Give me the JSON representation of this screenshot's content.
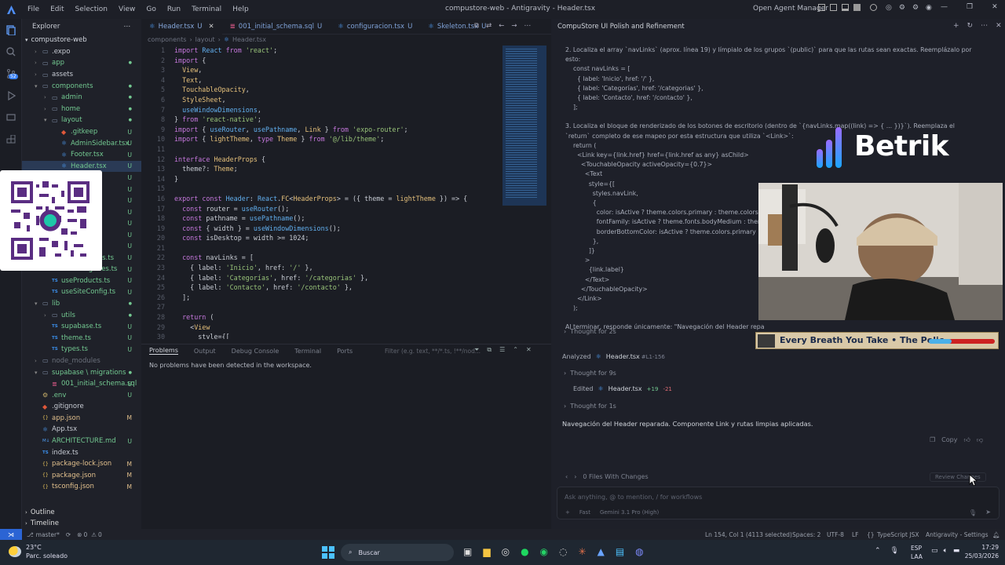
{
  "titlebar": {
    "menus": [
      "File",
      "Edit",
      "Selection",
      "View",
      "Go",
      "Run",
      "Terminal",
      "Help"
    ],
    "title": "compustore-web - Antigravity - Header.tsx",
    "open_agent_manager": "Open Agent Manager"
  },
  "explorer": {
    "title": "Explorer",
    "project": "compustore-web",
    "items": [
      {
        "label": ".expo",
        "indent": 1,
        "type": "folder",
        "status": ""
      },
      {
        "label": "app",
        "indent": 1,
        "type": "folder",
        "status": "dot"
      },
      {
        "label": "assets",
        "indent": 1,
        "type": "folder",
        "status": ""
      },
      {
        "label": "components",
        "indent": 1,
        "type": "folder-open",
        "status": "dot"
      },
      {
        "label": "admin",
        "indent": 2,
        "type": "folder",
        "status": "dot"
      },
      {
        "label": "home",
        "indent": 2,
        "type": "folder",
        "status": "dot"
      },
      {
        "label": "layout",
        "indent": 2,
        "type": "folder-open",
        "status": "dot"
      },
      {
        "label": ".gitkeep",
        "indent": 3,
        "type": "file",
        "status": "U"
      },
      {
        "label": "AdminSidebar.tsx",
        "indent": 3,
        "type": "file",
        "status": "U"
      },
      {
        "label": "Footer.tsx",
        "indent": 3,
        "type": "file",
        "status": "U"
      },
      {
        "label": "Header.tsx",
        "indent": 3,
        "type": "file",
        "status": "U"
      },
      {
        "label": "...tsx",
        "indent": 3,
        "type": "file",
        "status": "U"
      },
      {
        "label": "",
        "indent": 3,
        "type": "file",
        "status": "U"
      },
      {
        "label": "...tsx",
        "indent": 3,
        "type": "file",
        "status": "U"
      },
      {
        "label": "",
        "indent": 3,
        "type": "file",
        "status": "U"
      },
      {
        "label": "",
        "indent": 3,
        "type": "file",
        "status": "U"
      },
      {
        "label": "",
        "indent": 3,
        "type": "file",
        "status": "U"
      },
      {
        "label": "",
        "indent": 3,
        "type": "file",
        "status": "U"
      },
      {
        "label": "useCarousels.ts",
        "indent": 2,
        "type": "file",
        "status": "U"
      },
      {
        "label": "useCategories.ts",
        "indent": 2,
        "type": "file",
        "status": "U"
      },
      {
        "label": "useProducts.ts",
        "indent": 2,
        "type": "file",
        "status": "U"
      },
      {
        "label": "useSiteConfig.ts",
        "indent": 2,
        "type": "file",
        "status": "U"
      },
      {
        "label": "lib",
        "indent": 1,
        "type": "folder-open",
        "status": "dot"
      },
      {
        "label": "utils",
        "indent": 2,
        "type": "folder",
        "status": "dot"
      },
      {
        "label": "supabase.ts",
        "indent": 2,
        "type": "file",
        "status": "U"
      },
      {
        "label": "theme.ts",
        "indent": 2,
        "type": "file",
        "status": "U"
      },
      {
        "label": "types.ts",
        "indent": 2,
        "type": "file",
        "status": "U"
      },
      {
        "label": "node_modules",
        "indent": 1,
        "type": "folder",
        "status": ""
      },
      {
        "label": "supabase \\ migrations",
        "indent": 1,
        "type": "folder-open",
        "status": "dot"
      },
      {
        "label": "001_initial_schema.sql",
        "indent": 2,
        "type": "file",
        "status": "U"
      },
      {
        "label": ".env",
        "indent": 1,
        "type": "file",
        "status": "U"
      },
      {
        "label": ".gitignore",
        "indent": 1,
        "type": "file",
        "status": ""
      },
      {
        "label": "app.json",
        "indent": 1,
        "type": "file",
        "status": "M"
      },
      {
        "label": "App.tsx",
        "indent": 1,
        "type": "file",
        "status": ""
      },
      {
        "label": "ARCHITECTURE.md",
        "indent": 1,
        "type": "file",
        "status": "U"
      },
      {
        "label": "index.ts",
        "indent": 1,
        "type": "file",
        "status": ""
      },
      {
        "label": "package-lock.json",
        "indent": 1,
        "type": "file",
        "status": "M"
      },
      {
        "label": "package.json",
        "indent": 1,
        "type": "file",
        "status": "M"
      },
      {
        "label": "tsconfig.json",
        "indent": 1,
        "type": "file",
        "status": "M"
      }
    ],
    "outline": "Outline",
    "timeline": "Timeline"
  },
  "editor": {
    "tabs": [
      {
        "label": "Header.tsx",
        "status": "U",
        "active": true
      },
      {
        "label": "001_initial_schema.sql",
        "status": "U",
        "active": false
      },
      {
        "label": "configuracion.tsx",
        "status": "U",
        "active": false
      },
      {
        "label": "Skeleton.tsx",
        "status": "U",
        "active": false
      }
    ],
    "breadcrumb": [
      "components",
      "layout",
      "Header.tsx"
    ],
    "lines": [
      "import React from 'react';",
      "import {",
      "  View,",
      "  Text,",
      "  TouchableOpacity,",
      "  StyleSheet,",
      "  useWindowDimensions,",
      "} from 'react-native';",
      "import { useRouter, usePathname, Link } from 'expo-router';",
      "import { lightTheme, type Theme } from '@/lib/theme';",
      "",
      "interface HeaderProps {",
      "  theme?: Theme;",
      "}",
      "",
      "export const Header: React.FC<HeaderProps> = ({ theme = lightTheme }) => {",
      "  const router = useRouter();",
      "  const pathname = usePathname();",
      "  const { width } = useWindowDimensions();",
      "  const isDesktop = width >= 1024;",
      "",
      "  const navLinks = [",
      "    { label: 'Inicio', href: '/' },",
      "    { label: 'Categorías', href: '/categorias' },",
      "    { label: 'Contacto', href: '/contacto' },",
      "  ];",
      "",
      "  return (",
      "    <View",
      "      style={["
    ]
  },
  "panel": {
    "tabs": [
      "Problems",
      "Output",
      "Debug Console",
      "Terminal",
      "Ports"
    ],
    "filter_placeholder": "Filter (e.g. text, **/*.ts, !**/nod...",
    "message": "No problems have been detected in the workspace."
  },
  "chat": {
    "title": "CompuStore UI Polish and Refinement",
    "step2": "2.  Localiza el array `navLinks` (aprox. línea 19) y límpialo de los grupos `(public)` para que las rutas sean exactas. Reemplázalo por esto:",
    "step2_code": [
      "const navLinks = [",
      "  { label: 'Inicio', href: '/' },",
      "  { label: 'Categorías', href: '/categorias' },",
      "  { label: 'Contacto', href: '/contacto' },",
      "];"
    ],
    "step3": "3.  Localiza el bloque de renderizado de los botones de escritorio (dentro de `{navLinks.map((link) => { ... })}`). Reemplaza el `return` completo de ese mapeo por esta estructura que utiliza `<Link>`:",
    "step3_code": [
      "return (",
      "  <Link key={link.href} href={link.href as any} asChild>",
      "    <TouchableOpacity activeOpacity={0.7}>",
      "      <Text",
      "        style={[",
      "          styles.navLink,",
      "          {",
      "            color: isActive ? theme.colors.primary : theme.colors.te",
      "            fontFamily: isActive ? theme.fonts.bodyMedium : theme.f",
      "            borderBottomColor: isActive ? theme.colors.primary : '",
      "          },",
      "        ]}",
      "      >",
      "        {link.label}",
      "      </Text>",
      "    </TouchableOpacity>",
      "  </Link>",
      ");"
    ],
    "final_instruction": "Al terminar, responde únicamente: \"Navegación del Header repa",
    "thought1": "Thought for 2s",
    "analyzed_label": "Analyzed",
    "analyzed_file": "Header.tsx",
    "analyzed_range": "#L1-156",
    "thought2": "Thought for 9s",
    "edited_label": "Edited",
    "edited_file": "Header.tsx",
    "edited_plus": "+19",
    "edited_minus": "-21",
    "thought3": "Thought for 1s",
    "response": "Navegación del Header reparada. Componente Link y rutas limpias aplicadas.",
    "copy": "Copy",
    "files_changed": "0 Files With Changes",
    "review_changes": "Review Changes",
    "input_placeholder": "Ask anything, @ to mention, / for workflows",
    "mode": "Fast",
    "model": "Gemini 3.1 Pro (High)"
  },
  "overlays": {
    "brand": "Betrik",
    "music_ticker": "Every Breath You Take  •  The Polic"
  },
  "statusbar": {
    "branch": "master*",
    "errors": "0",
    "warnings": "0",
    "position": "Ln 154, Col 1 (4113 selected)",
    "spaces": "Spaces: 2",
    "encoding": "UTF-8",
    "eol": "LF",
    "language": "TypeScript JSX",
    "settings": "Antigravity - Settings"
  },
  "taskbar": {
    "temperature": "23°C",
    "weather": "Parc. soleado",
    "search": "Buscar",
    "lang1": "ESP",
    "lang2": "LAA",
    "time": "17:29",
    "date": "25/03/2026"
  },
  "colors": {
    "accent": "#3b82f6",
    "bg": "#1b1d24",
    "explorer_bg": "#1f2129",
    "chat_bg": "#1e2029",
    "untracked": "#73c991",
    "modified": "#e2c08d"
  }
}
